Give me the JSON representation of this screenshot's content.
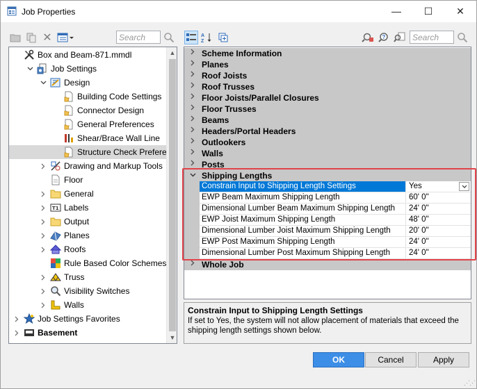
{
  "window": {
    "title": "Job Properties",
    "minimize_glyph": "—",
    "maximize_glyph": "☐",
    "close_glyph": "✕"
  },
  "left_toolbar": {
    "search_placeholder": "Search"
  },
  "right_toolbar": {
    "search_placeholder": "Search"
  },
  "tree": {
    "items": [
      {
        "label": "Box and Beam-871.mmdl",
        "icon": "tools-icon",
        "expander": "",
        "bold": false
      },
      {
        "label": "Job Settings",
        "icon": "job-settings-icon",
        "expander": "v",
        "bold": false
      },
      {
        "label": "Design",
        "icon": "design-icon",
        "expander": "v",
        "bold": false
      },
      {
        "label": "Building Code Settings",
        "icon": "settings-doc-icon",
        "expander": "",
        "bold": false
      },
      {
        "label": "Connector Design",
        "icon": "settings-doc-icon",
        "expander": "",
        "bold": false
      },
      {
        "label": "General Preferences",
        "icon": "settings-doc-icon",
        "expander": "",
        "bold": false
      },
      {
        "label": "Shear/Brace Wall Line",
        "icon": "shear-wall-icon",
        "expander": "",
        "bold": false
      },
      {
        "label": "Structure Check Preferences",
        "icon": "settings-doc-icon",
        "expander": "",
        "bold": false,
        "selected": true
      },
      {
        "label": "Drawing and Markup Tools",
        "icon": "drawing-tools-icon",
        "expander": ">",
        "bold": false
      },
      {
        "label": "Floor",
        "icon": "floor-icon",
        "expander": "",
        "bold": false
      },
      {
        "label": "General",
        "icon": "folder-icon",
        "expander": ">",
        "bold": false
      },
      {
        "label": "Labels",
        "icon": "labels-icon",
        "expander": ">",
        "bold": false
      },
      {
        "label": "Output",
        "icon": "folder-icon",
        "expander": ">",
        "bold": false
      },
      {
        "label": "Planes",
        "icon": "planes-icon",
        "expander": ">",
        "bold": false
      },
      {
        "label": "Roofs",
        "icon": "roofs-icon",
        "expander": ">",
        "bold": false
      },
      {
        "label": "Rule Based Color Schemes",
        "icon": "color-scheme-icon",
        "expander": "",
        "bold": false
      },
      {
        "label": "Truss",
        "icon": "truss-icon",
        "expander": ">",
        "bold": false
      },
      {
        "label": "Visibility Switches",
        "icon": "visibility-icon",
        "expander": ">",
        "bold": false
      },
      {
        "label": "Walls",
        "icon": "walls-icon",
        "expander": ">",
        "bold": false
      },
      {
        "label": "Job Settings Favorites",
        "icon": "favorites-star-icon",
        "expander": ">",
        "bold": false
      },
      {
        "label": "Basement",
        "icon": "basement-icon",
        "expander": ">",
        "bold": true
      }
    ]
  },
  "grid": {
    "categories_top": [
      "Scheme Information",
      "Planes",
      "Roof Joists",
      "Roof Trusses",
      "Floor Joists/Parallel Closures",
      "Floor Trusses",
      "Beams",
      "Headers/Portal Headers",
      "Outlookers",
      "Walls",
      "Posts"
    ],
    "expanded_category": "Shipping Lengths",
    "properties": [
      {
        "name": "Constrain Input to Shipping Length Settings",
        "value": "Yes"
      },
      {
        "name": "EWP Beam Maximum Shipping Length",
        "value": "60' 0\""
      },
      {
        "name": "Dimensional Lumber Beam Maximum Shipping Length",
        "value": "24' 0\""
      },
      {
        "name": "EWP Joist Maximum Shipping Length",
        "value": "48' 0\""
      },
      {
        "name": "Dimensional Lumber Joist Maximum Shipping Length",
        "value": "20' 0\""
      },
      {
        "name": "EWP Post Maximum Shipping Length",
        "value": "24' 0\""
      },
      {
        "name": "Dimensional Lumber Post Maximum Shipping Length",
        "value": "24' 0\""
      }
    ],
    "last_category": "Whole Job"
  },
  "description": {
    "title": "Constrain Input to Shipping Length Settings",
    "text": "If set to Yes, the system will not allow placement of materials that exceed the shipping length settings shown below."
  },
  "buttons": {
    "ok": "OK",
    "cancel": "Cancel",
    "apply": "Apply"
  },
  "colors": {
    "accent": "#0078d7",
    "highlight_border": "#e2434a",
    "category_bg": "#c8c8c8",
    "ok_button": "#3d8ee6"
  }
}
